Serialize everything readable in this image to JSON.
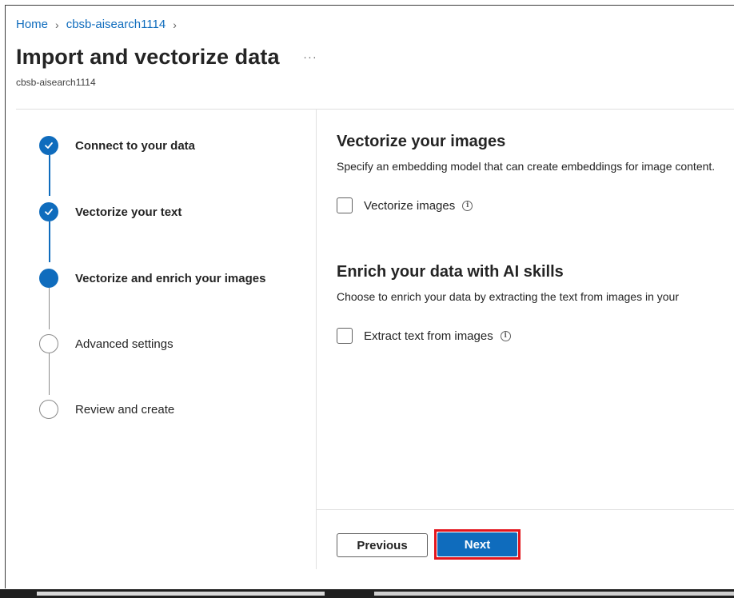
{
  "breadcrumb": {
    "home": "Home",
    "resource": "cbsb-aisearch1114"
  },
  "header": {
    "title": "Import and vectorize data",
    "more": "...",
    "subtitle": "cbsb-aisearch1114"
  },
  "steps": [
    {
      "label": "Connect to your data",
      "state": "completed"
    },
    {
      "label": "Vectorize your text",
      "state": "completed"
    },
    {
      "label": "Vectorize and enrich your images",
      "state": "current"
    },
    {
      "label": "Advanced settings",
      "state": "upcoming"
    },
    {
      "label": "Review and create",
      "state": "upcoming"
    }
  ],
  "main": {
    "vectorize_section": {
      "title": "Vectorize your images",
      "description": "Specify an embedding model that can create embeddings for image content.",
      "checkbox_label": "Vectorize images",
      "checked": false
    },
    "enrich_section": {
      "title": "Enrich your data with AI skills",
      "description": "Choose to enrich your data by extracting the text from images in your",
      "checkbox_label": "Extract text from images",
      "checked": false
    }
  },
  "footer": {
    "previous_label": "Previous",
    "next_label": "Next"
  },
  "colors": {
    "accent": "#0f6cbd",
    "highlight": "#e3161d"
  }
}
